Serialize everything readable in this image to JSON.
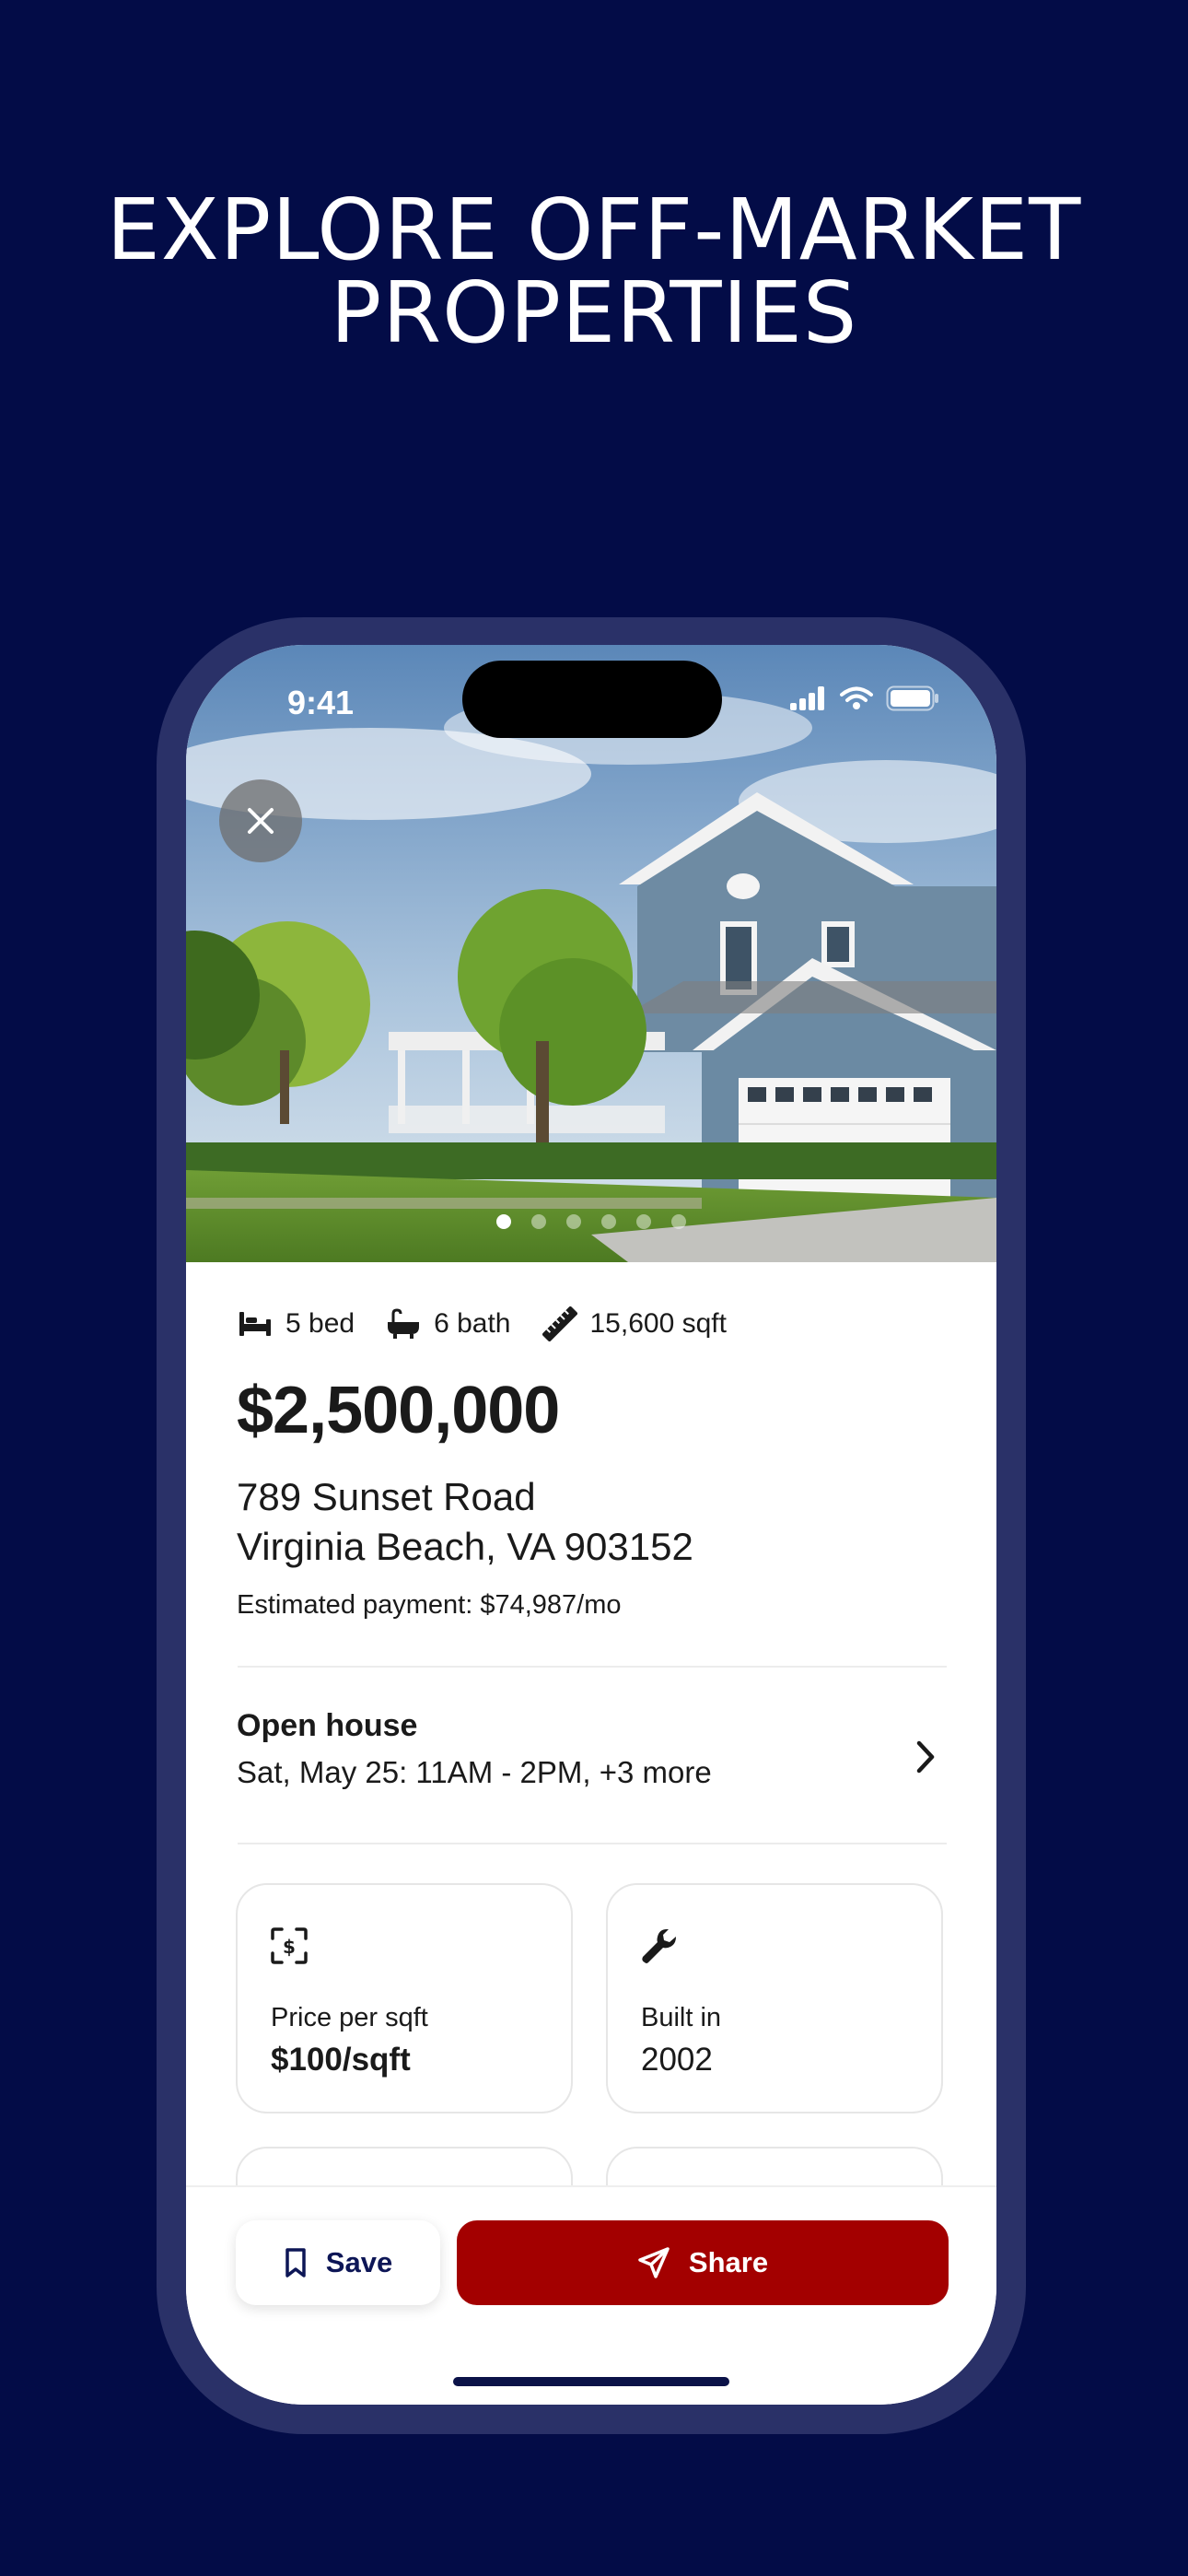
{
  "promo": {
    "headline_line1": "EXPLORE OFF-MARKET",
    "headline_line2": "PROPERTIES"
  },
  "status_bar": {
    "time": "9:41"
  },
  "gallery": {
    "photo_count": 6,
    "active_index": 0
  },
  "listing": {
    "beds": "5 bed",
    "baths": "6 bath",
    "sqft": "15,600 sqft",
    "price": "$2,500,000",
    "address_line1": "789 Sunset Road",
    "address_line2": "Virginia Beach, VA 903152",
    "estimated_payment": "Estimated payment: $74,987/mo"
  },
  "open_house": {
    "title": "Open house",
    "schedule": "Sat, May 25: 11AM - 2PM, +3 more"
  },
  "facts": [
    {
      "label": "Price per sqft",
      "value": "$100/sqft",
      "icon": "dollar-scan-icon"
    },
    {
      "label": "Built in",
      "value": "2002",
      "icon": "wrench-icon"
    }
  ],
  "actions": {
    "save_label": "Save",
    "share_label": "Share"
  },
  "colors": {
    "background": "#030c47",
    "phone_frame": "#2a3168",
    "share_button": "#a30000",
    "save_text": "#0d1656"
  }
}
